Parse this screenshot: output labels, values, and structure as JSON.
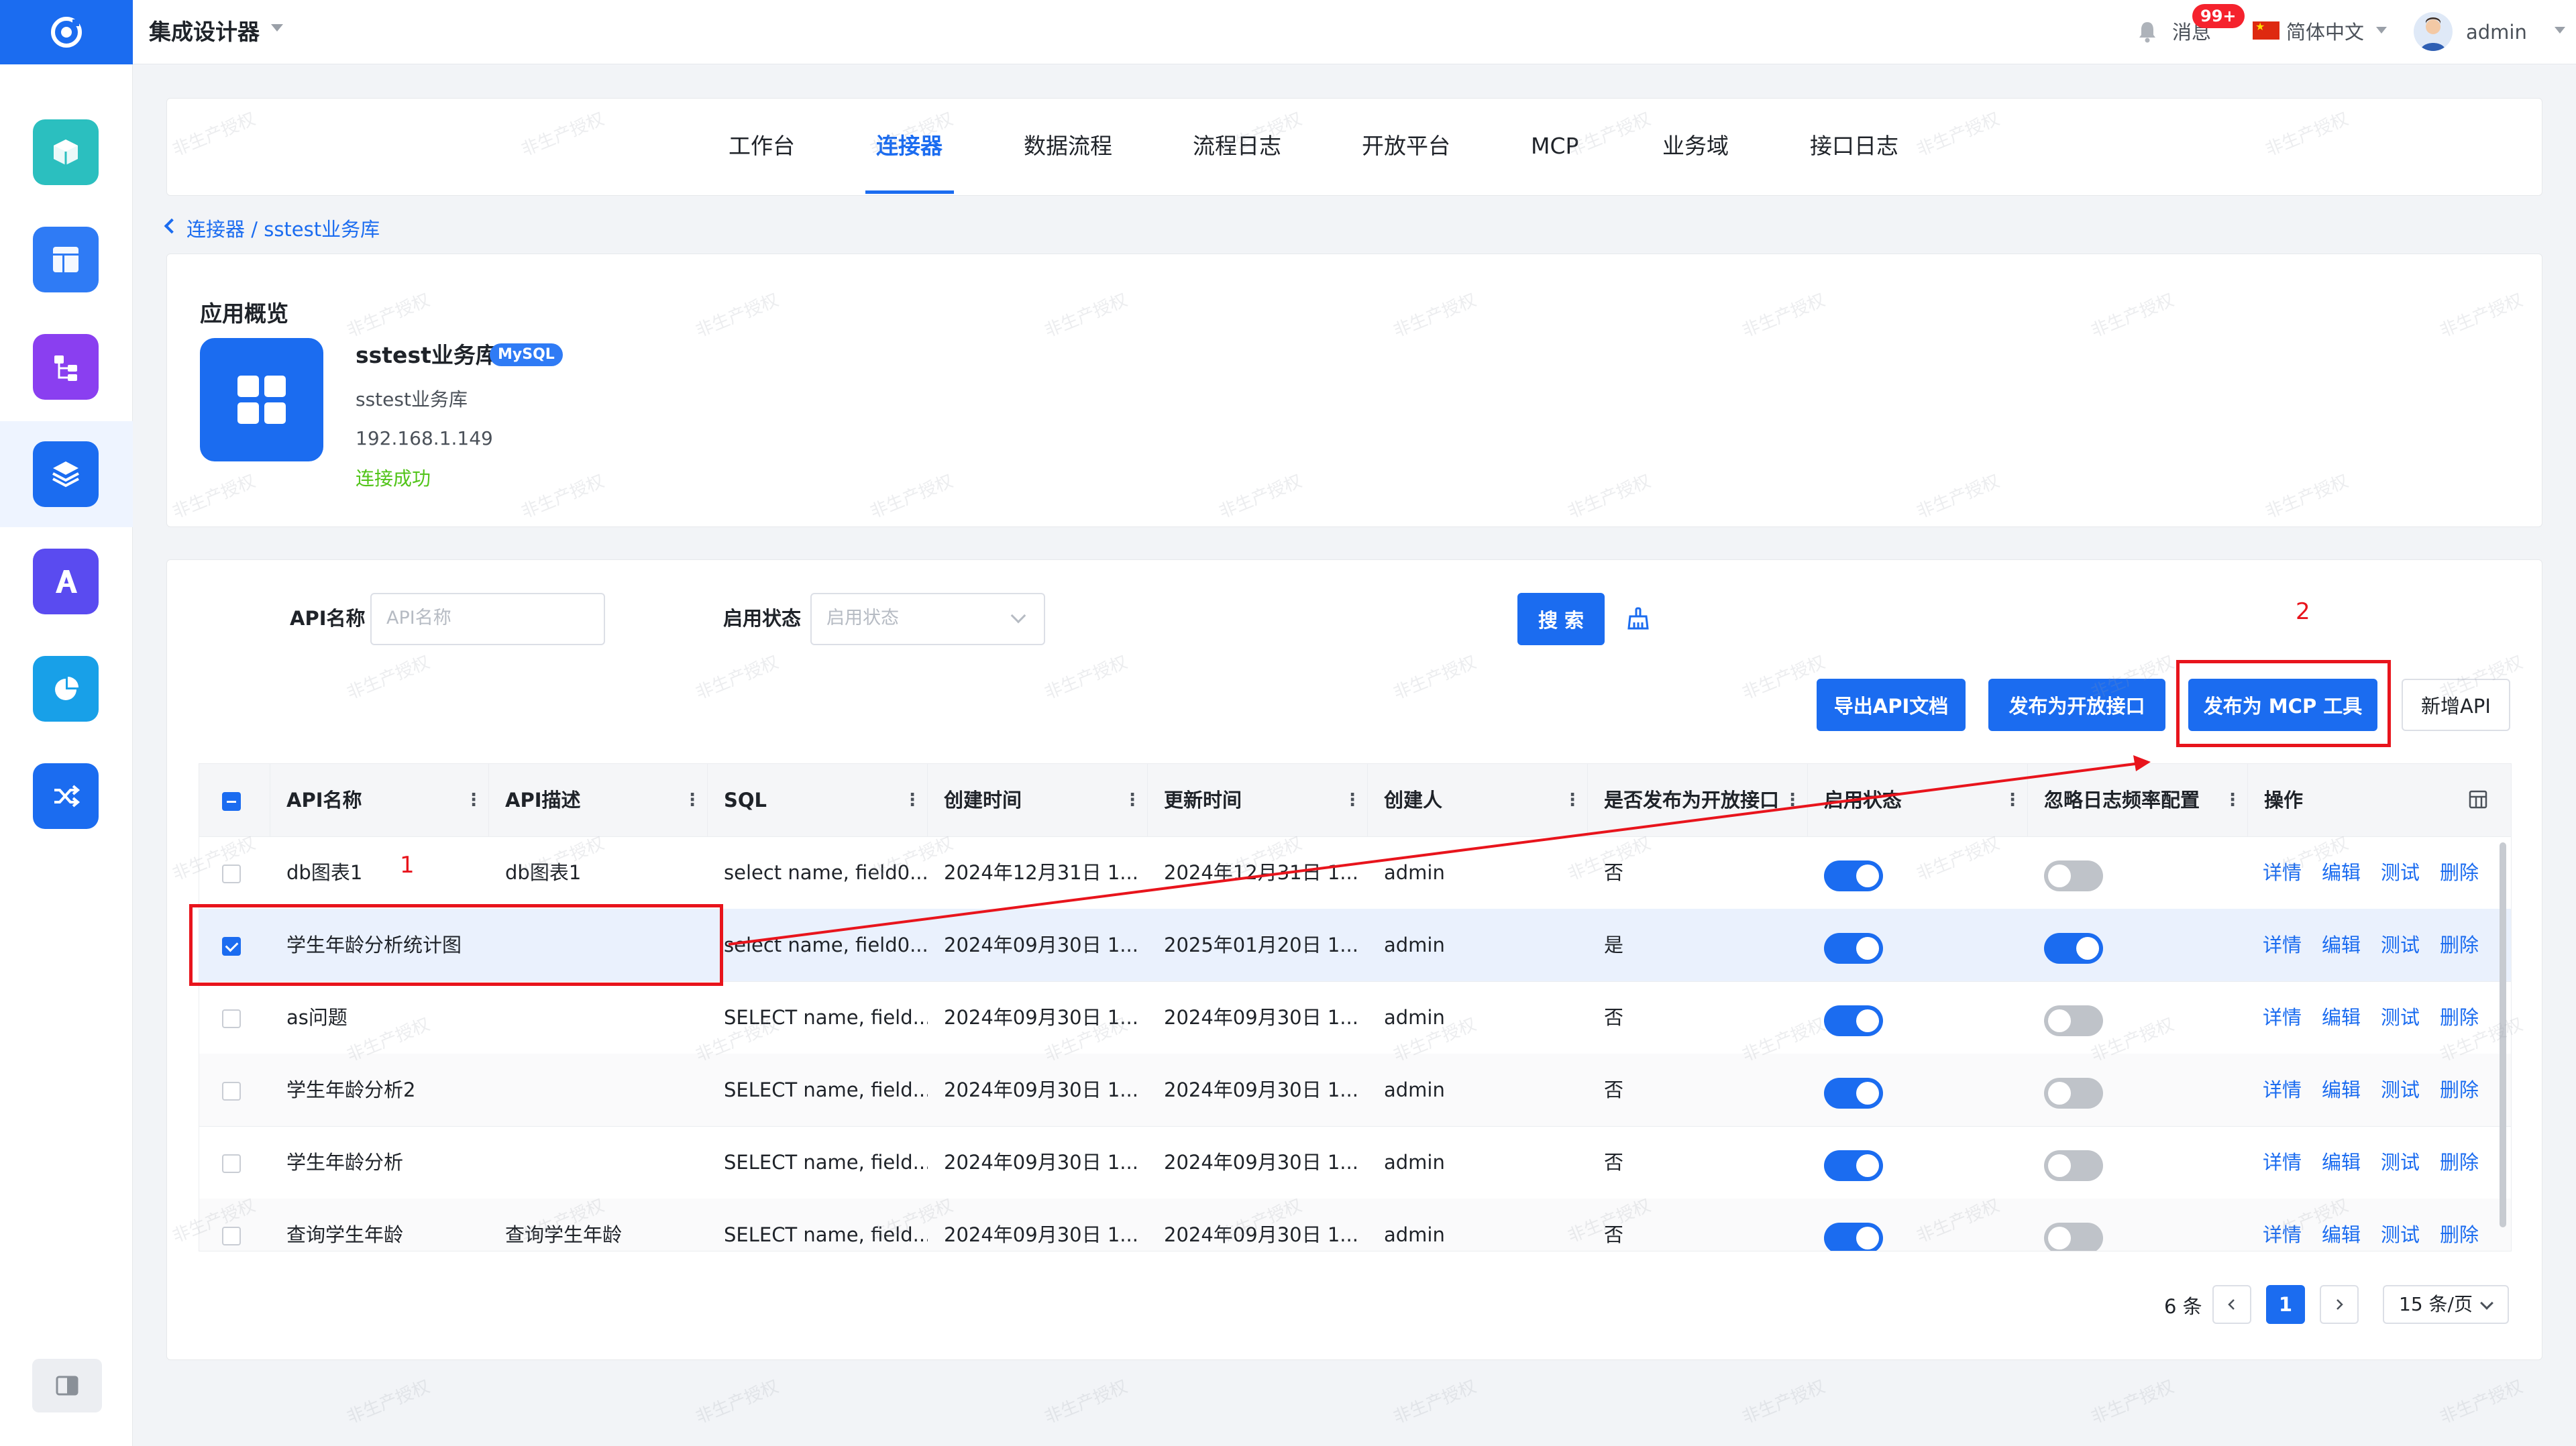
{
  "header": {
    "app_title": "集成设计器",
    "messages_label": "消息",
    "messages_badge": "99+",
    "language": "简体中文",
    "user": "admin"
  },
  "sidebar": {
    "items": [
      {
        "name": "cube",
        "color": "#2bbfbf"
      },
      {
        "name": "layout",
        "color": "#2f7bf5"
      },
      {
        "name": "flow",
        "color": "#8a3ff0"
      },
      {
        "name": "layers",
        "color": "#1b6cf0",
        "active": true
      },
      {
        "name": "ai",
        "color": "#5a4bf0"
      },
      {
        "name": "chart",
        "color": "#18a0e8"
      },
      {
        "name": "shuffle",
        "color": "#1b6cf0"
      }
    ]
  },
  "nav": {
    "tabs": [
      "工作台",
      "连接器",
      "数据流程",
      "流程日志",
      "开放平台",
      "MCP",
      "业务域",
      "接口日志"
    ],
    "active_index": 1
  },
  "breadcrumb": "连接器 / sstest业务库",
  "overview": {
    "title": "应用概览",
    "name": "sstest业务库",
    "db_type": "MySQL",
    "description": "sstest业务库",
    "host": "192.168.1.149",
    "status": "连接成功"
  },
  "filters": {
    "api_name_label": "API名称",
    "api_name_placeholder": "API名称",
    "status_label": "启用状态",
    "status_placeholder": "启用状态",
    "search_button": "搜 索"
  },
  "actions": {
    "export": "导出API文档",
    "publish_open": "发布为开放接口",
    "publish_mcp": "发布为 MCP 工具",
    "add": "新增API"
  },
  "table": {
    "columns": [
      "API名称",
      "API描述",
      "SQL",
      "创建时间",
      "更新时间",
      "创建人",
      "是否发布为开放接口",
      "启用状态",
      "忽略日志频率配置",
      "操作"
    ],
    "row_ops": [
      "详情",
      "编辑",
      "测试",
      "删除"
    ],
    "rows": [
      {
        "name": "db图表1",
        "desc": "db图表1",
        "sql": "select name, field0...",
        "created": "2024年12月31日 1...",
        "updated": "2024年12月31日 1...",
        "creator": "admin",
        "published": "否",
        "enabled": true,
        "ignore_log": false,
        "checked": false
      },
      {
        "name": "学生年龄分析统计图",
        "desc": "",
        "sql": "select name, field0...",
        "created": "2024年09月30日 1...",
        "updated": "2025年01月20日 1...",
        "creator": "admin",
        "published": "是",
        "enabled": true,
        "ignore_log": true,
        "checked": true
      },
      {
        "name": "as问题",
        "desc": "",
        "sql": "SELECT name, field...",
        "created": "2024年09月30日 1...",
        "updated": "2024年09月30日 1...",
        "creator": "admin",
        "published": "否",
        "enabled": true,
        "ignore_log": false,
        "checked": false
      },
      {
        "name": "学生年龄分析2",
        "desc": "",
        "sql": "SELECT name, field...",
        "created": "2024年09月30日 1...",
        "updated": "2024年09月30日 1...",
        "creator": "admin",
        "published": "否",
        "enabled": true,
        "ignore_log": false,
        "checked": false
      },
      {
        "name": "学生年龄分析",
        "desc": "",
        "sql": "SELECT name, field...",
        "created": "2024年09月30日 1...",
        "updated": "2024年09月30日 1...",
        "creator": "admin",
        "published": "否",
        "enabled": true,
        "ignore_log": false,
        "checked": false
      },
      {
        "name": "查询学生年龄",
        "desc": "查询学生年龄",
        "sql": "SELECT name, field...",
        "created": "2024年09月30日 1...",
        "updated": "2024年09月30日 1...",
        "creator": "admin",
        "published": "否",
        "enabled": true,
        "ignore_log": false,
        "checked": false
      }
    ]
  },
  "pagination": {
    "total": "6 条",
    "current_page": "1",
    "page_size": "15 条/页"
  },
  "annotations": {
    "step1": "1",
    "step2": "2",
    "color": "#e8141c"
  },
  "watermark": "非生产授权"
}
